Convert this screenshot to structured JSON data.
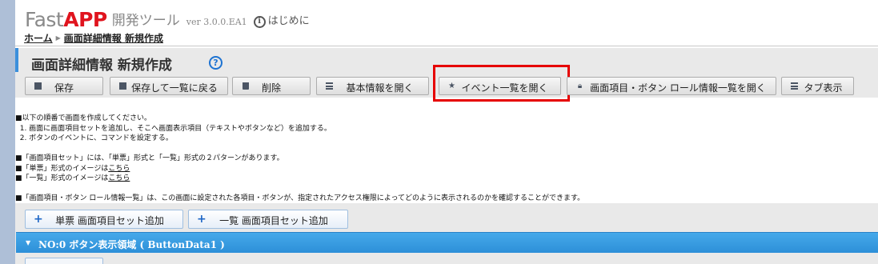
{
  "header": {
    "logo_fast": "Fast",
    "logo_app": "APP",
    "devtool": "開発ツール",
    "version": "ver 3.0.0.EA1",
    "about_label": "はじめに"
  },
  "breadcrumb": {
    "home": "ホーム",
    "current": "画面詳細情報 新規作成"
  },
  "page": {
    "title": "画面詳細情報 新規作成",
    "help": "?"
  },
  "toolbar": {
    "save": "保存",
    "save_back": "保存して一覧に戻る",
    "delete": "削除",
    "basic_info": "基本情報を開く",
    "event_list": "イベント一覧を開く",
    "role_list": "画面項目・ボタン ロール情報一覧を開く",
    "tab_view": "タブ表示"
  },
  "instructions": {
    "l1": "■以下の順番で画面を作成してください。",
    "l2": "  1. 画面に画面項目セットを追加し、そこへ画面表示項目（テキストやボタンなど）を追加する。",
    "l3": "  2. ボタンのイベントに、コマンドを設定する。",
    "l4": "■「画面項目セット」には、「単票」形式と「一覧」形式の２パターンがあります。",
    "l5_pre": "■「単票」形式のイメージは",
    "l6_pre": "■「一覧」形式のイメージは",
    "link": "こちら",
    "l7": "■「画面項目・ボタン ロール情報一覧」は、この画面に設定された各項目・ボタンが、指定されたアクセス権限によってどのように表示されるのかを確認することができます。"
  },
  "sections": {
    "add_single": "単票 画面項目セット追加",
    "add_list": "一覧 画面項目セット追加",
    "section_title": "NO:0 ボタン表示領域 ( ButtonData1 )"
  }
}
